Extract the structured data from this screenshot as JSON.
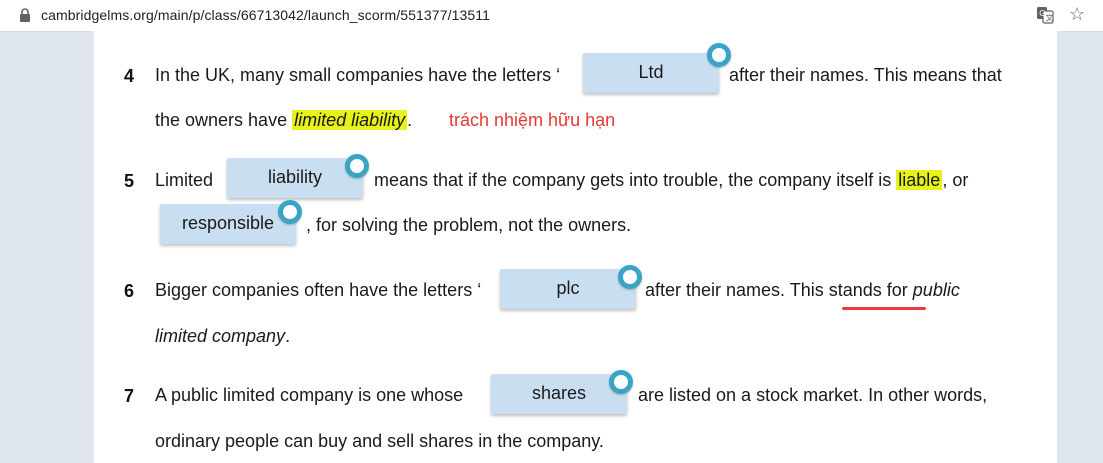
{
  "browser": {
    "url": "cambridgelms.org/main/p/class/66713042/launch_scorm/551377/13511"
  },
  "items": [
    {
      "number": "4",
      "line1_a": "In the UK, many small companies have the letters ‘",
      "answer1": "Ltd",
      "line1_b": "after their names. This means that",
      "line2_a": "the owners have ",
      "term": "limited liability",
      "line2_b": ".",
      "note": "trách nhiệm hữu hạn"
    },
    {
      "number": "5",
      "line1_a": "Limited",
      "answer1": "liability",
      "line1_b": "means that if the company gets into trouble, the company itself is ",
      "term": "liable",
      "line1_c": ", or",
      "answer2": "responsible",
      "line2_b": ", for solving the problem, not the owners."
    },
    {
      "number": "6",
      "line1_a": "Bigger companies often have the letters ‘",
      "answer1": "plc",
      "line1_b": "after their names. This stands for ",
      "term": "public",
      "line2_a": "limited company",
      "line2_b": "."
    },
    {
      "number": "7",
      "line1_a": "A public limited company is one whose",
      "answer1": "shares",
      "line1_b": "are listed on a stock market. In other words,",
      "line2_a": "ordinary people can buy and sell shares in the company."
    }
  ],
  "colors": {
    "chip": "#c9dff1",
    "dot": "#3aa4c7",
    "highlight": "#e6f21a",
    "note": "#e53935"
  },
  "icons": [
    "lock-icon",
    "translate-icon",
    "star-icon",
    "handle-icon"
  ]
}
